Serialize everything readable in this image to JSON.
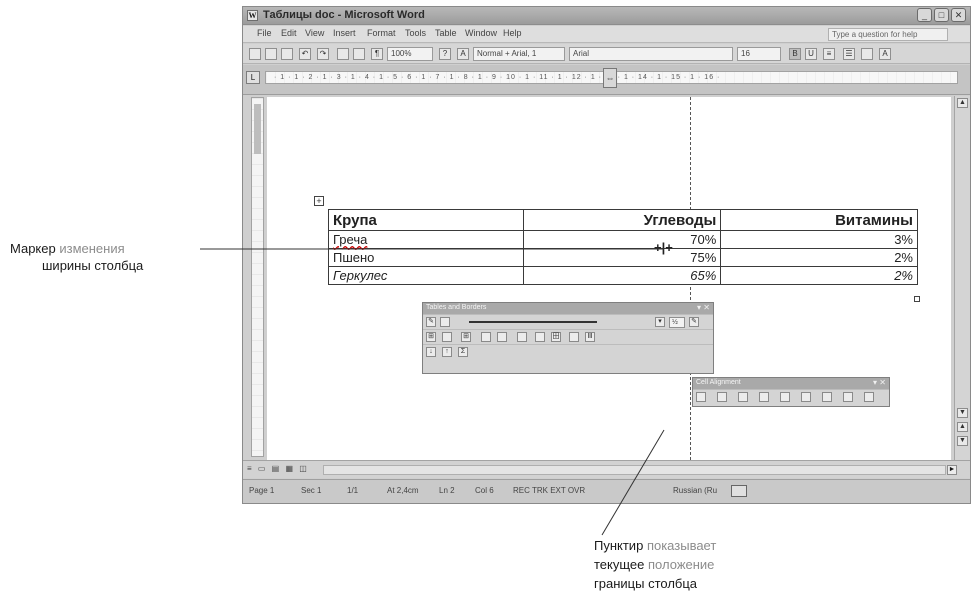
{
  "window": {
    "title": "Таблицы doc - Microsoft Word"
  },
  "menu": {
    "items": [
      "File",
      "Edit",
      "View",
      "Insert",
      "Format",
      "Tools",
      "Table",
      "Window",
      "Help"
    ],
    "ask_placeholder": "Type a question for help"
  },
  "toolbar": {
    "zoom": "100%",
    "style": "Normal + Arial, 1",
    "font": "Arial",
    "font_size": "16"
  },
  "ruler": {
    "numbers": "· 1 · 1 · 2 · 1 · 3 · 1 · 4 · 1 · 5 ·     6 · 1 · 7 · 1 · 8 · 1 · 9 ·   10 · 1 · 11 · 1 · 12 · 1 · 13 · 1 · 14 · 1 · 15 · 1 · 16 ·"
  },
  "table": {
    "headers": [
      "Крупа",
      "Углеводы",
      "Витамины"
    ],
    "rows": [
      [
        "Греча",
        "70%",
        "3%"
      ],
      [
        "Пшено",
        "75%",
        "2%"
      ],
      [
        "Геркулес",
        "65%",
        "2%"
      ]
    ]
  },
  "tables_toolbar": {
    "title": "Tables and Borders",
    "weight": "½"
  },
  "cell_align_toolbar": {
    "title": "Cell Alignment"
  },
  "status": {
    "page": "Page 1",
    "sec": "Sec 1",
    "pages": "1/1",
    "at": "At 2,4cm",
    "ln": "Ln 2",
    "col": "Col 6",
    "modes": "REC  TRK  EXT  OVR",
    "lang": "Russian (Ru"
  },
  "callouts": {
    "left": {
      "line1_a": "Маркер",
      "line1_b": "изменения",
      "line2": "ширины столбца"
    },
    "bottom": {
      "line1_a": "Пунктир",
      "line1_b": "показывает",
      "line2_a": "текущее",
      "line2_b": "положение",
      "line3_a": "границы",
      "line3_b": "столбца"
    }
  }
}
